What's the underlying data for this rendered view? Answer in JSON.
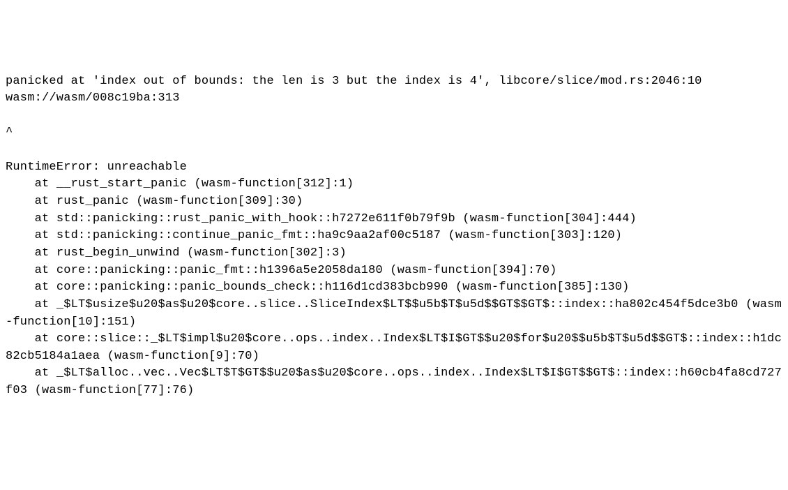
{
  "console": {
    "panic_line": "panicked at 'index out of bounds: the len is 3 but the index is 4', libcore/slice/mod.rs:2046:10",
    "wasm_source": "wasm://wasm/008c19ba:313",
    "blank1": "",
    "caret": "^",
    "blank2": "",
    "error_header": "RuntimeError: unreachable",
    "stack": [
      "    at __rust_start_panic (wasm-function[312]:1)",
      "    at rust_panic (wasm-function[309]:30)",
      "    at std::panicking::rust_panic_with_hook::h7272e611f0b79f9b (wasm-function[304]:444)",
      "    at std::panicking::continue_panic_fmt::ha9c9aa2af00c5187 (wasm-function[303]:120)",
      "    at rust_begin_unwind (wasm-function[302]:3)",
      "    at core::panicking::panic_fmt::h1396a5e2058da180 (wasm-function[394]:70)",
      "    at core::panicking::panic_bounds_check::h116d1cd383bcb990 (wasm-function[385]:130)",
      "    at _$LT$usize$u20$as$u20$core..slice..SliceIndex$LT$$u5b$T$u5d$$GT$$GT$::index::ha802c454f5dce3b0 (wasm-function[10]:151)",
      "    at core::slice::_$LT$impl$u20$core..ops..index..Index$LT$I$GT$$u20$for$u20$$u5b$T$u5d$$GT$::index::h1dc82cb5184a1aea (wasm-function[9]:70)",
      "    at _$LT$alloc..vec..Vec$LT$T$GT$$u20$as$u20$core..ops..index..Index$LT$I$GT$$GT$::index::h60cb4fa8cd727f03 (wasm-function[77]:76)"
    ]
  }
}
